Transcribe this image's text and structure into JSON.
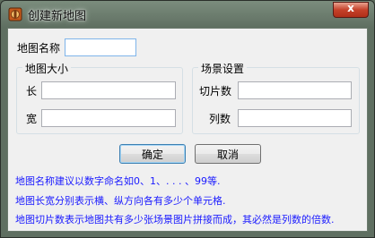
{
  "window": {
    "title": "创建新地图",
    "close_glyph": "x"
  },
  "form": {
    "map_name_label": "地图名称",
    "map_name_value": ""
  },
  "map_size": {
    "title": "地图大小",
    "length_label": "长",
    "length_value": "",
    "width_label": "宽",
    "width_value": ""
  },
  "scene": {
    "title": "场景设置",
    "tiles_label": "切片数",
    "tiles_value": "",
    "columns_label": "列数",
    "columns_value": ""
  },
  "buttons": {
    "ok": "确定",
    "cancel": "取消"
  },
  "hints": [
    "地图名称建议以数字命名如0、1、. . . 、99等.",
    "地图长宽分别表示横、纵方向各有多少个单元格.",
    "地图切片数表示地图共有多少张场景图片拼接而成，其必然是列数的倍数."
  ],
  "colors": {
    "hint_text": "#1a1aff",
    "titlebar": "#5f6f61",
    "close_button": "#c5412a"
  },
  "icons": {
    "app": "map-app-icon",
    "close": "close-icon"
  }
}
